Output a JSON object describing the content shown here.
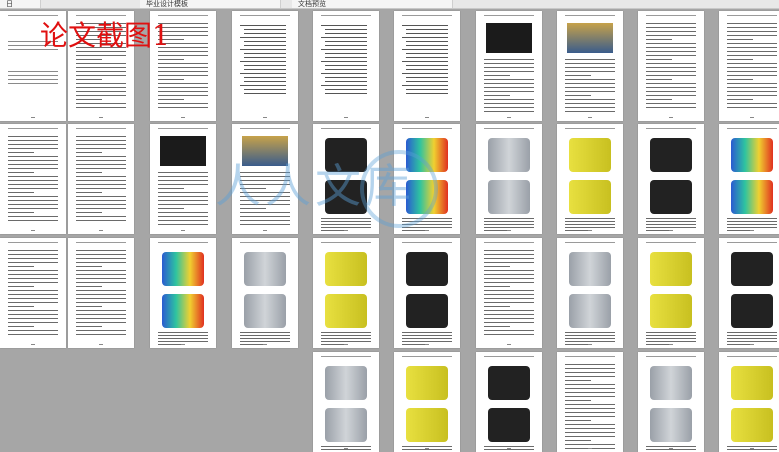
{
  "caption": "论文截图1",
  "watermark": {
    "text": "人人文库",
    "color": "#5aa0d7"
  },
  "tabs": [
    {
      "label": "日",
      "icon": "doc-icon"
    },
    {
      "label": "毕业设计模板",
      "icon": "doc-icon"
    },
    {
      "label": "文档预览",
      "icon": "doc-icon"
    }
  ],
  "colors": {
    "background": "#a6a6a6",
    "caption": "#e01010",
    "page": "#ffffff"
  }
}
